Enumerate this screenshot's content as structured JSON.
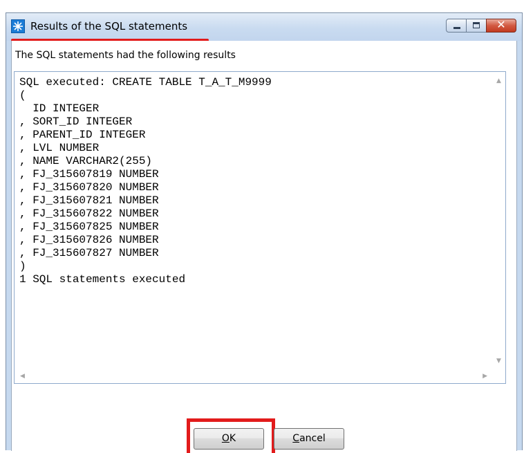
{
  "window": {
    "title": "Results of the SQL statements",
    "app_icon": "app-logo-icon",
    "controls": {
      "minimize_icon": "minimize-icon",
      "maximize_icon": "maximize-icon",
      "close_icon": "close-icon"
    }
  },
  "dialog": {
    "intro": "The SQL statements had the following results",
    "result_lines": [
      "SQL executed: CREATE TABLE T_A_T_M9999",
      "(",
      "  ID INTEGER",
      ", SORT_ID INTEGER",
      ", PARENT_ID INTEGER",
      ", LVL NUMBER",
      ", NAME VARCHAR2(255)",
      ", FJ_315607819 NUMBER",
      ", FJ_315607820 NUMBER",
      ", FJ_315607821 NUMBER",
      ", FJ_315607822 NUMBER",
      ", FJ_315607825 NUMBER",
      ", FJ_315607826 NUMBER",
      ", FJ_315607827 NUMBER",
      ")",
      "1 SQL statements executed"
    ],
    "scroll_icons": {
      "up": "scroll-up-arrow-icon",
      "down": "scroll-down-arrow-icon",
      "left": "scroll-left-arrow-icon",
      "right": "scroll-right-arrow-icon"
    }
  },
  "buttons": {
    "ok": {
      "mnemonic": "O",
      "rest": "K"
    },
    "cancel": {
      "mnemonic": "C",
      "rest": "ancel"
    }
  },
  "colors": {
    "annotation": "#e21b1b",
    "title_bar": "#c9dbf0",
    "close_button": "#c23a20"
  }
}
